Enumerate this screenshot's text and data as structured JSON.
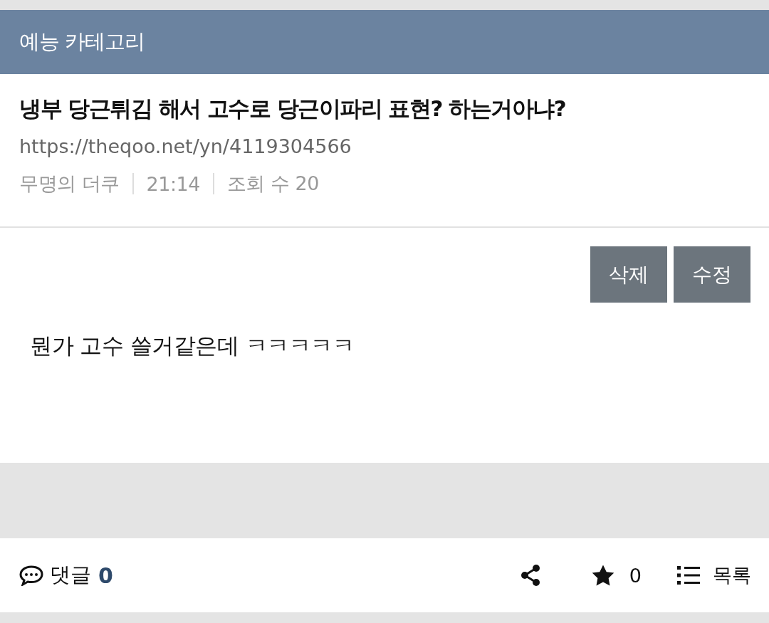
{
  "category": "예능 카테고리",
  "post": {
    "title": "냉부 당근튀김 해서 고수로 당근이파리 표현? 하는거아냐?",
    "url": "https://theqoo.net/yn/4119304566",
    "meta": [
      "무명의 더쿠",
      "21:14",
      "조회 수 20"
    ]
  },
  "actions": [
    "삭제",
    "수정"
  ],
  "body": "뭔가 고수 쓸거같은데 ㅋㅋㅋㅋㅋ",
  "footer": {
    "comments_label": "댓글",
    "comments_count": "0",
    "favorites_count": "0",
    "list_label": "목록"
  }
}
